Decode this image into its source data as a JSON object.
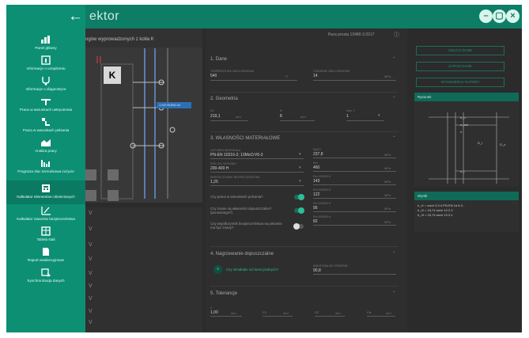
{
  "window": {
    "title": "ektor",
    "back_icon": "arrow-left-icon",
    "controls": [
      "minimize-icon",
      "maximize-icon",
      "close-icon"
    ]
  },
  "nav": [
    {
      "label": "Panel główny",
      "icon": "dashboard-icon"
    },
    {
      "label": "Informacje o urządzeniu",
      "icon": "device-info-icon"
    },
    {
      "label": "Informacje o diagnostyce",
      "icon": "diagnostics-icon"
    },
    {
      "label": "Praca w warunkach ustręciennia",
      "icon": "tools-icon"
    },
    {
      "label": "Praca w warunkach pełzania",
      "icon": "creep-icon"
    },
    {
      "label": "Analiza pracy",
      "icon": "chart-area-icon"
    },
    {
      "label": "Prognoza zlac szerunkowa zużycie",
      "icon": "bar-chart-icon"
    },
    {
      "label": "Kalkulator elementów ciśnieniowych",
      "icon": "calculator-icon",
      "active": true
    },
    {
      "label": "Kalkulator zaworów bezpieczeństwa",
      "icon": "valve-chart-icon"
    },
    {
      "label": "Tabela stali",
      "icon": "table-icon"
    },
    {
      "label": "Raport ewidencyjnowe",
      "icon": "report-icon"
    },
    {
      "label": "Synchronizacja danych",
      "icon": "sync-icon"
    }
  ],
  "schema": {
    "header": "ogów wyprowadzonych z kotła K",
    "boiler_label": "K",
    "tag_label": "1 KO RURA 04",
    "side_letters": [
      "V",
      "V",
      "V",
      "V",
      "V",
      "V",
      "V",
      "V",
      "V"
    ]
  },
  "form": {
    "norm": "Rura prosta 13480-3:2017",
    "sections": [
      {
        "title": "1. Dane"
      },
      {
        "title": "2. Geometria"
      },
      {
        "title": "3. WŁASNOŚCI MATERIAŁOWE"
      },
      {
        "title": "4. Nagrzewanie dopuszczalne"
      },
      {
        "title": "5. Tolerancje"
      }
    ],
    "dane": [
      {
        "label": "TEMPERATURA OBLICZENIOWA",
        "value": "540",
        "unit": "°C"
      },
      {
        "label": "CIŚNIENIE OBLICZENIOWE",
        "value": "14",
        "unit": "MPa"
      }
    ],
    "geometry": [
      {
        "label": "De",
        "value": "219,1",
        "unit": "mm"
      },
      {
        "label": "tn",
        "value": "8",
        "unit": "mm"
      },
      {
        "label": "max. T",
        "value": "1",
        "unit": ""
      }
    ],
    "material": [
      {
        "label": "GATUNEK MATERIAŁU",
        "value": "PN-EN 10216-2; 13MoCrV6-3"
      },
      {
        "label": "ROD ZAJ WYROBU",
        "value": "200-400 H"
      },
      {
        "label": "WSPÓŁCZYNNIK BEZPIECZEŃSTWA",
        "value": "1,25"
      }
    ],
    "material_right": [
      {
        "label": "Rp0,2",
        "value": "237,8",
        "unit": "MPa"
      },
      {
        "label": "Rm",
        "value": "460",
        "unit": "MPa"
      },
      {
        "label": "Rm 100000 H",
        "value": "143",
        "unit": "MPa"
      },
      {
        "label": "Rm 200000 H",
        "value": "122",
        "unit": "MPa"
      },
      {
        "label": "Rm 100000 H",
        "value": "95",
        "unit": "MPa"
      },
      {
        "label": "Rm 200000 H",
        "value": "82",
        "unit": "MPa"
      }
    ],
    "questions": [
      {
        "text": "Czy praca w warunkach pełzania?",
        "on": true
      },
      {
        "text": "Czy znane są własności dopuszczalne? (ponownego?)",
        "on": true
      },
      {
        "text": "Czy współczynnik bezpieczeństwa na pełzanie ma być znany?",
        "on": false
      }
    ],
    "heating": {
      "question": "Czy strzałobie od ziemi jezdnych?",
      "label": "MAKSYMALNE CIŚNIENIE",
      "value": "90,8"
    },
    "tolerance": [
      {
        "label": "e",
        "value": "1,00",
        "unit": "mm"
      },
      {
        "label": "C1",
        "value": "",
        "unit": "mm"
      },
      {
        "label": "C2",
        "value": "",
        "unit": "mm"
      },
      {
        "label": "Ca",
        "value": "",
        "unit": "mm"
      }
    ]
  },
  "right": {
    "buttons": [
      "OBLICZ DANE",
      "ZAPISZ DANE",
      "WYGENERUJ RAPORT"
    ],
    "diagram_title": "Rysunek",
    "diagram_labels": [
      "e_n",
      "e_act",
      "e",
      "D_o",
      "D_i",
      "e_r"
    ],
    "results_title": "Wynik",
    "results": [
      [
        "e_r1",
        "=",
        "wzór 3.3.4 PN-EN 1a 6.3",
        "-"
      ],
      [
        "e_r2",
        "=",
        "24,74",
        "wzór 13.2.3"
      ],
      [
        "e_r3",
        "=",
        "24,74",
        "wzór 13.3.1"
      ]
    ]
  }
}
